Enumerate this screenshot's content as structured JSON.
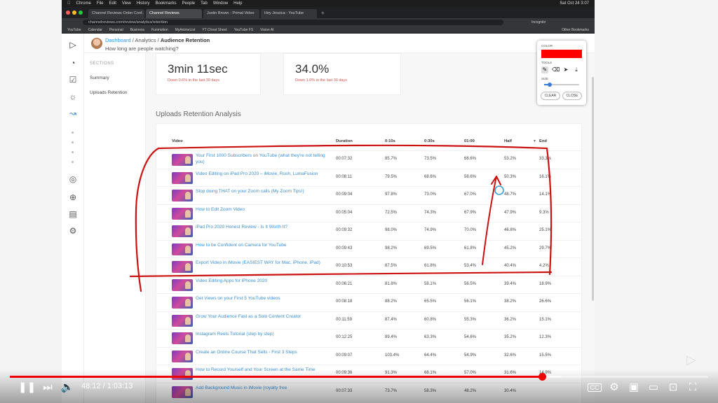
{
  "menubar": {
    "items": [
      "Chrome",
      "File",
      "Edit",
      "View",
      "History",
      "Bookmarks",
      "People",
      "Tab",
      "Window",
      "Help"
    ],
    "clock": "Sat Oct 24 3:07"
  },
  "browser": {
    "tabs": [
      "Channel Reviews Order Conf...",
      "Channel Reviews",
      "Justin Brown - Primal Video",
      "Hey Jessica - YouTube"
    ],
    "url": "channelreviews.com/review/analytics/retention",
    "profile": "Incognito",
    "bookmarks": [
      "YouTube",
      "Calendar",
      "Personal",
      "Business",
      "Funmotion",
      "MyAnimeList",
      "YT Cheat Sheet",
      "YouTube FS",
      "Vision AI"
    ],
    "other_bookmarks": "Other Bookmarks"
  },
  "app": {
    "breadcrumb": {
      "dashboard": "Dashboard",
      "sep1": " / ",
      "analytics": "Analytics",
      "sep2": " / ",
      "current": "Audience Retention"
    },
    "subtitle": "How long are people watching?",
    "sections_header": "SECTIONS",
    "section_items": [
      "Summary",
      "Uploads Retention"
    ],
    "stats": [
      {
        "value": "3min  11sec",
        "change": "Down 0.6% in the last 30 days"
      },
      {
        "value": "34.0%",
        "change": "Down 1.0% in the last 30 days"
      }
    ],
    "table_title": "Uploads Retention Analysis",
    "columns": [
      "Video",
      "Duration",
      "0:10s",
      "0:30s",
      "01:00",
      "Half",
      "End"
    ],
    "rows": [
      {
        "title": "Your First 1000 Subscribers on YouTube (what they're not telling you)",
        "duration": "00:07:32",
        "s10": "85.7%",
        "s30": "73.5%",
        "m1": "68.6%",
        "half": "53.2%",
        "end": "33.3%"
      },
      {
        "title": "Video Editing on iPad Pro 2020 – iMovie, Rush, LumaFusion",
        "duration": "00:08:11",
        "s10": "79.5%",
        "s30": "68.6%",
        "m1": "58.6%",
        "half": "50.3%",
        "end": "16.1%"
      },
      {
        "title": "Stop doing THAT on your Zoom calls (My Zoom Tips!)",
        "duration": "00:09:04",
        "s10": "97.8%",
        "s30": "73.0%",
        "m1": "67.0%",
        "half": "48.7%",
        "end": "14.1%"
      },
      {
        "title": "How to Edit Zoom Video",
        "duration": "00:05:04",
        "s10": "72.5%",
        "s30": "74.3%",
        "m1": "67.9%",
        "half": "47.9%",
        "end": "9.3%"
      },
      {
        "title": "iPad Pro 2020 Honest Review - Is It Worth It?",
        "duration": "00:09:32",
        "s10": "98.0%",
        "s30": "74.9%",
        "m1": "70.0%",
        "half": "46.8%",
        "end": "25.1%"
      },
      {
        "title": "How to be Confident on Camera for YouTube",
        "duration": "00:09:43",
        "s10": "98.2%",
        "s30": "69.5%",
        "m1": "61.8%",
        "half": "45.2%",
        "end": "29.7%"
      },
      {
        "title": "Export Video in iMovie (EASIEST WAY for Mac, iPhone, iPad)",
        "duration": "00:10:53",
        "s10": "87.5%",
        "s30": "61.8%",
        "m1": "53.4%",
        "half": "40.4%",
        "end": "4.2%"
      },
      {
        "title": "Video Editing Apps for iPhone 2020",
        "duration": "00:06:21",
        "s10": "81.8%",
        "s30": "58.1%",
        "m1": "56.5%",
        "half": "39.4%",
        "end": "18.9%"
      },
      {
        "title": "Get Views on your First 5 YouTube videos",
        "duration": "00:08:18",
        "s10": "88.2%",
        "s30": "65.5%",
        "m1": "56.1%",
        "half": "38.2%",
        "end": "26.6%"
      },
      {
        "title": "Grow Your Audience Fast as a Solo Content Creator",
        "duration": "00:11:59",
        "s10": "87.4%",
        "s30": "60.8%",
        "m1": "55.3%",
        "half": "36.2%",
        "end": "15.1%"
      },
      {
        "title": "Instagram Reels Tutorial (step by step)",
        "duration": "00:12:25",
        "s10": "89.4%",
        "s30": "63.3%",
        "m1": "54.6%",
        "half": "35.2%",
        "end": "12.3%"
      },
      {
        "title": "Create an Online Course That Sells - First 3 Steps",
        "duration": "00:09:07",
        "s10": "103.4%",
        "s30": "64.4%",
        "m1": "54.9%",
        "half": "32.6%",
        "end": "15.5%"
      },
      {
        "title": "How to Record Yourself and Your Screen at the Same Time",
        "duration": "00:09:36",
        "s10": "91.3%",
        "s30": "68.1%",
        "m1": "57.0%",
        "half": "31.6%",
        "end": "14.9%"
      },
      {
        "title": "Add Background Music in iMovie (royalty free",
        "duration": "00:07:33",
        "s10": "73.7%",
        "s30": "58.3%",
        "m1": "48.2%",
        "half": "30.4%",
        "end": ""
      }
    ]
  },
  "toolbox": {
    "color_label": "COLOR",
    "color_value": "#ff0000",
    "tools_label": "TOOLS",
    "size_label": "SIZE",
    "size_level": 0.15,
    "clear_label": "CLEAR",
    "close_label": "CLOSE"
  },
  "player": {
    "time_text": "48:12 / 1:03:13",
    "progress": 0.7624,
    "buffered": 0.79
  }
}
